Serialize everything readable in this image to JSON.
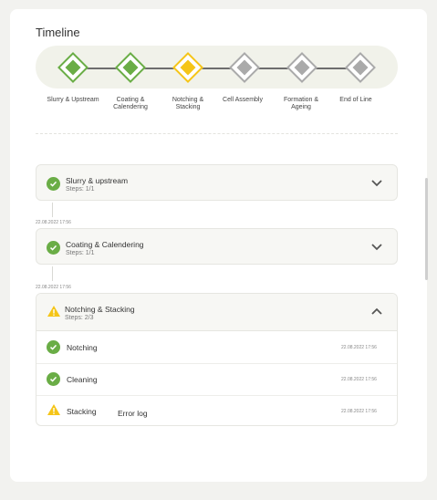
{
  "page": {
    "title": "Timeline"
  },
  "timeline": {
    "steps": [
      {
        "label": "Slurry & Upstream",
        "status": "done"
      },
      {
        "label": "Coating & Calendering",
        "status": "done"
      },
      {
        "label": "Notching & Stacking",
        "status": "warning"
      },
      {
        "label": "Cell Assembly",
        "status": "pending"
      },
      {
        "label": "Formation & Ageing",
        "status": "pending"
      },
      {
        "label": "End of Line",
        "status": "pending"
      }
    ]
  },
  "stages": [
    {
      "name": "Slurry & upstream",
      "steps": "Steps: 1/1",
      "status": "done",
      "timestamp": "22.08.2022 17:56"
    },
    {
      "name": "Coating & Calendering",
      "steps": "Steps: 1/1",
      "status": "done",
      "timestamp": "22.08.2022 17:56"
    },
    {
      "name": "Notching & Stacking",
      "steps": "Steps: 2/3",
      "status": "warning",
      "substeps": [
        {
          "name": "Notching",
          "status": "done",
          "timestamp": "22.08.2022 17:56"
        },
        {
          "name": "Cleaning",
          "status": "done",
          "timestamp": "22.08.2022 17:56"
        },
        {
          "name": "Stacking",
          "status": "warning",
          "timestamp": "22.08.2022 17:56",
          "extra": "Error log"
        }
      ]
    }
  ],
  "colors": {
    "done": "#6aad46",
    "warning": "#f5c518",
    "pending": "#a6a6a6"
  }
}
